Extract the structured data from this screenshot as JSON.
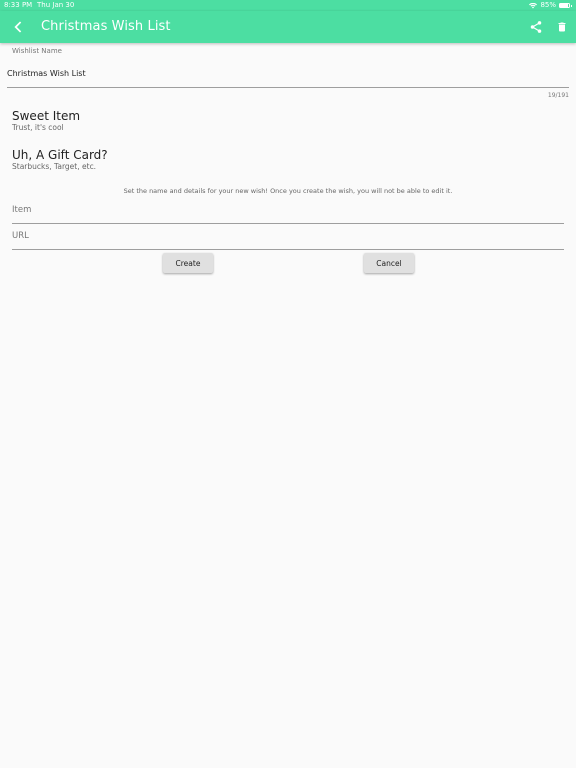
{
  "status_bar": {
    "time": "8:33 PM",
    "date": "Thu Jan 30",
    "battery": "85%",
    "battery_level": 0.85
  },
  "app_bar": {
    "title": "Christmas Wish List",
    "background_color": "#4cdea2",
    "back_icon": "chevron-left-icon",
    "share_icon": "share-icon",
    "delete_icon": "trash-icon"
  },
  "wishlist_name": {
    "label": "Wishlist Name",
    "value": "Christmas Wish List",
    "counter": "19/191"
  },
  "wishes": [
    {
      "title": "Sweet Item",
      "subtitle": "Trust, it's cool"
    },
    {
      "title": "Uh, A Gift Card?",
      "subtitle": "Starbucks, Target, etc."
    }
  ],
  "new_wish": {
    "helper_text": "Set the name and details for your new wish! Once you create the wish, you will not be able to edit it.",
    "item_placeholder": "Item",
    "url_placeholder": "URL",
    "create_label": "Create",
    "cancel_label": "Cancel"
  }
}
